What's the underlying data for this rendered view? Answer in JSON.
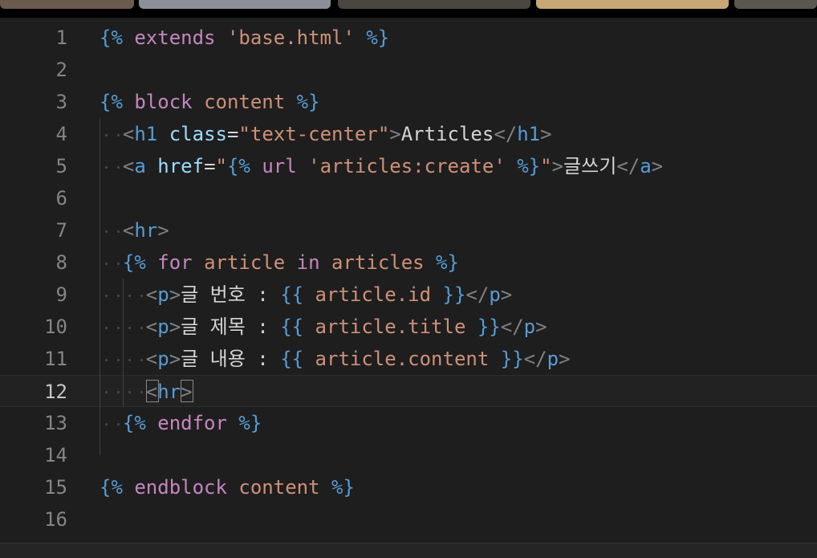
{
  "window": {
    "meeting_thumbnails": [
      {
        "name": "participant-1",
        "color": "#6b5a4e"
      },
      {
        "name": "participant-2",
        "color": "#8a8f98"
      },
      {
        "name": "participant-3",
        "color": "#4a4740"
      },
      {
        "name": "participant-4",
        "color": "#c7a774"
      },
      {
        "name": "participant-5",
        "color": "#5c5650"
      }
    ]
  },
  "editor": {
    "current_line": 12,
    "lines": [
      {
        "num": "1",
        "tokens": [
          {
            "t": "tmpl",
            "v": "{%"
          },
          {
            "t": "kw",
            "v": " extends "
          },
          {
            "t": "str",
            "v": "'base.html'"
          },
          {
            "t": "tmpl",
            "v": " %}"
          }
        ]
      },
      {
        "num": "2",
        "tokens": []
      },
      {
        "num": "3",
        "tokens": [
          {
            "t": "tmpl",
            "v": "{%"
          },
          {
            "t": "kw",
            "v": " block "
          },
          {
            "t": "var",
            "v": "content"
          },
          {
            "t": "tmpl",
            "v": " %}"
          }
        ]
      },
      {
        "num": "4",
        "tokens": [
          {
            "t": "punct",
            "v": "  "
          },
          {
            "t": "br",
            "v": "<"
          },
          {
            "t": "tag",
            "v": "h1"
          },
          {
            "t": "punct",
            "v": " "
          },
          {
            "t": "attr",
            "v": "class"
          },
          {
            "t": "punct",
            "v": "="
          },
          {
            "t": "str",
            "v": "\"text-center\""
          },
          {
            "t": "br",
            "v": ">"
          },
          {
            "t": "text",
            "v": "Articles"
          },
          {
            "t": "br",
            "v": "</"
          },
          {
            "t": "tag",
            "v": "h1"
          },
          {
            "t": "br",
            "v": ">"
          }
        ]
      },
      {
        "num": "5",
        "tokens": [
          {
            "t": "punct",
            "v": "  "
          },
          {
            "t": "br",
            "v": "<"
          },
          {
            "t": "tag",
            "v": "a"
          },
          {
            "t": "punct",
            "v": " "
          },
          {
            "t": "attr",
            "v": "href"
          },
          {
            "t": "punct",
            "v": "="
          },
          {
            "t": "str",
            "v": "\""
          },
          {
            "t": "tmpl",
            "v": "{%"
          },
          {
            "t": "kw",
            "v": " url "
          },
          {
            "t": "str",
            "v": "'articles:create'"
          },
          {
            "t": "tmpl",
            "v": " %}"
          },
          {
            "t": "str",
            "v": "\""
          },
          {
            "t": "br",
            "v": ">"
          },
          {
            "t": "text",
            "v": "글쓰기"
          },
          {
            "t": "br",
            "v": "</"
          },
          {
            "t": "tag",
            "v": "a"
          },
          {
            "t": "br",
            "v": ">"
          }
        ]
      },
      {
        "num": "6",
        "tokens": []
      },
      {
        "num": "7",
        "tokens": [
          {
            "t": "punct",
            "v": "  "
          },
          {
            "t": "br",
            "v": "<"
          },
          {
            "t": "tag",
            "v": "hr"
          },
          {
            "t": "br",
            "v": ">"
          }
        ]
      },
      {
        "num": "8",
        "tokens": [
          {
            "t": "punct",
            "v": "  "
          },
          {
            "t": "tmpl",
            "v": "{%"
          },
          {
            "t": "kw",
            "v": " for "
          },
          {
            "t": "var",
            "v": "article"
          },
          {
            "t": "kw",
            "v": " in "
          },
          {
            "t": "var",
            "v": "articles"
          },
          {
            "t": "tmpl",
            "v": " %}"
          }
        ]
      },
      {
        "num": "9",
        "tokens": [
          {
            "t": "punct",
            "v": "    "
          },
          {
            "t": "br",
            "v": "<"
          },
          {
            "t": "tag",
            "v": "p"
          },
          {
            "t": "br",
            "v": ">"
          },
          {
            "t": "text",
            "v": "글 번호 : "
          },
          {
            "t": "tmpl",
            "v": "{{"
          },
          {
            "t": "var",
            "v": " article.id "
          },
          {
            "t": "tmpl",
            "v": "}}"
          },
          {
            "t": "br",
            "v": "</"
          },
          {
            "t": "tag",
            "v": "p"
          },
          {
            "t": "br",
            "v": ">"
          }
        ]
      },
      {
        "num": "10",
        "tokens": [
          {
            "t": "punct",
            "v": "    "
          },
          {
            "t": "br",
            "v": "<"
          },
          {
            "t": "tag",
            "v": "p"
          },
          {
            "t": "br",
            "v": ">"
          },
          {
            "t": "text",
            "v": "글 제목 : "
          },
          {
            "t": "tmpl",
            "v": "{{"
          },
          {
            "t": "var",
            "v": " article.title "
          },
          {
            "t": "tmpl",
            "v": "}}"
          },
          {
            "t": "br",
            "v": "</"
          },
          {
            "t": "tag",
            "v": "p"
          },
          {
            "t": "br",
            "v": ">"
          }
        ]
      },
      {
        "num": "11",
        "tokens": [
          {
            "t": "punct",
            "v": "    "
          },
          {
            "t": "br",
            "v": "<"
          },
          {
            "t": "tag",
            "v": "p"
          },
          {
            "t": "br",
            "v": ">"
          },
          {
            "t": "text",
            "v": "글 내용 : "
          },
          {
            "t": "tmpl",
            "v": "{{"
          },
          {
            "t": "var",
            "v": " article.content "
          },
          {
            "t": "tmpl",
            "v": "}}"
          },
          {
            "t": "br",
            "v": "</"
          },
          {
            "t": "tag",
            "v": "p"
          },
          {
            "t": "br",
            "v": ">"
          }
        ]
      },
      {
        "num": "12",
        "tokens": [
          {
            "t": "punct",
            "v": "    "
          },
          {
            "t": "br",
            "v": "<"
          },
          {
            "t": "tag",
            "v": "hr"
          },
          {
            "t": "br",
            "v": ">"
          }
        ]
      },
      {
        "num": "13",
        "tokens": [
          {
            "t": "punct",
            "v": "  "
          },
          {
            "t": "tmpl",
            "v": "{%"
          },
          {
            "t": "kw",
            "v": " endfor "
          },
          {
            "t": "tmpl",
            "v": "%}"
          }
        ]
      },
      {
        "num": "14",
        "tokens": []
      },
      {
        "num": "15",
        "tokens": [
          {
            "t": "tmpl",
            "v": "{%"
          },
          {
            "t": "kw",
            "v": " endblock "
          },
          {
            "t": "var",
            "v": "content"
          },
          {
            "t": "tmpl",
            "v": " %}"
          }
        ]
      },
      {
        "num": "16",
        "tokens": []
      }
    ]
  },
  "colors": {
    "background": "#1e1e1e",
    "line_number": "#858585",
    "line_number_active": "#c6c6c6",
    "template_delimiter": "#569cd6",
    "template_keyword": "#c586c0",
    "string": "#ce9178",
    "tag": "#569cd6",
    "attribute": "#9cdcfe",
    "text": "#d4d4d4"
  }
}
